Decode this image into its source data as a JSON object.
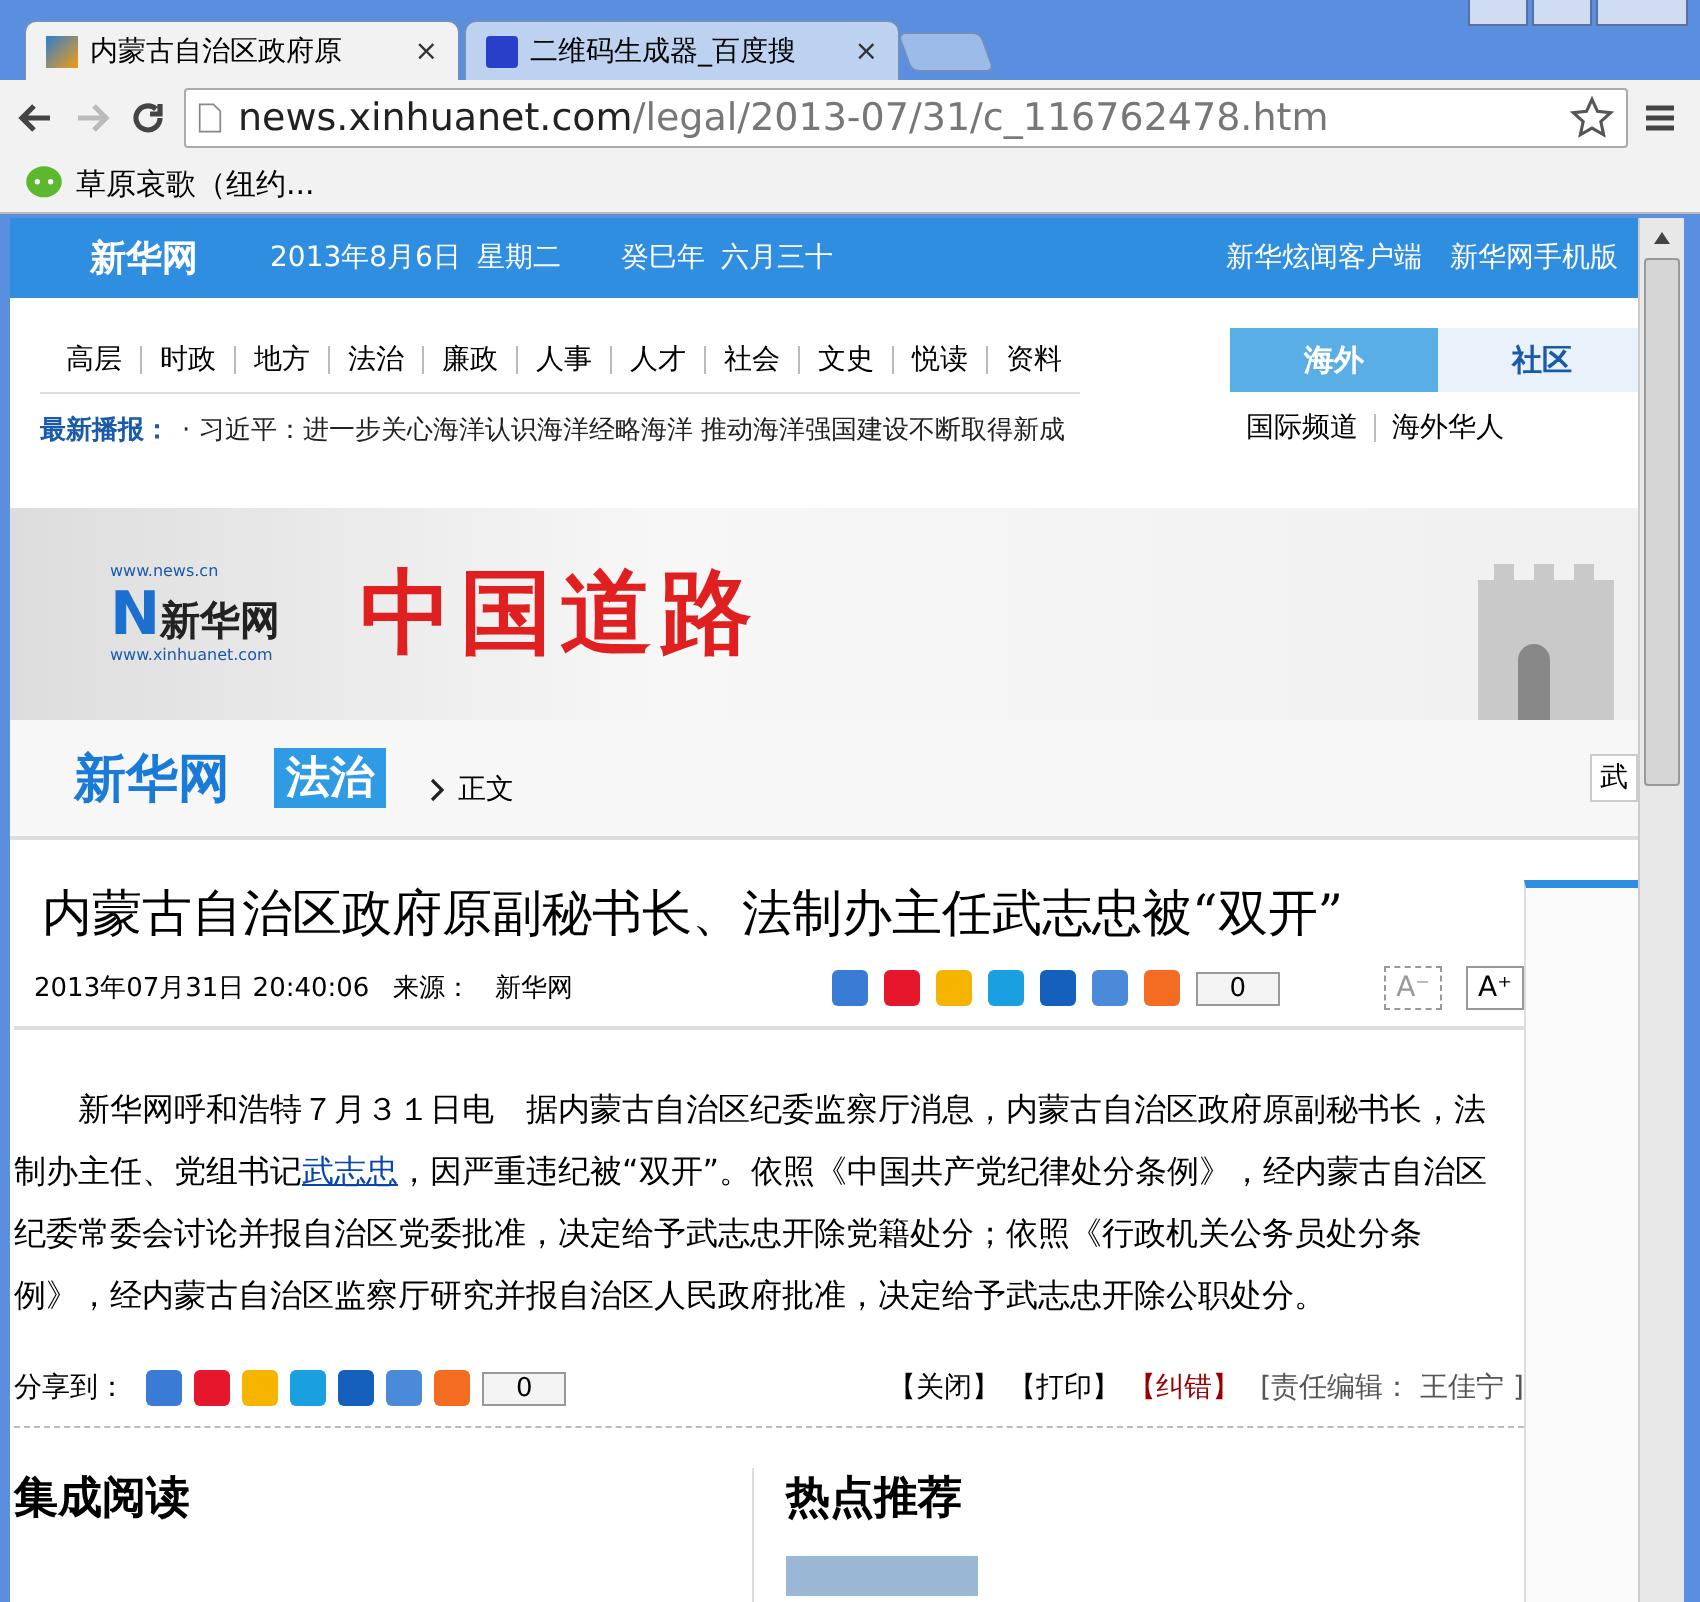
{
  "browser": {
    "tabs": [
      {
        "title": "内蒙古自治区政府原",
        "close": "×",
        "selected": true
      },
      {
        "title": "二维码生成器_百度搜",
        "close": "×",
        "selected": false
      }
    ],
    "url_host": "news.xinhuanet.com",
    "url_path": "/legal/2013-07/31/c_116762478.htm",
    "bookmark": "草原哀歌（纽约..."
  },
  "header": {
    "logo": "新华网",
    "date": "2013年8月6日",
    "weekday": "星期二",
    "lunar_year": "癸巳年",
    "lunar_day": "六月三十",
    "links": [
      "新华炫闻客户端",
      "新华网手机版"
    ]
  },
  "nav": {
    "items": [
      "高层",
      "时政",
      "地方",
      "法治",
      "廉政",
      "人事",
      "人才",
      "社会",
      "文史",
      "悦读",
      "资料"
    ],
    "ticker_label": "最新播报：",
    "ticker": "· 习近平：进一步关心海洋认识海洋经略海洋  推动海洋强国建设不断取得新成",
    "side_tabs": [
      {
        "label": "海外",
        "selected": true
      },
      {
        "label": "社区",
        "selected": false
      }
    ],
    "side_links": [
      "国际频道",
      "海外华人"
    ]
  },
  "banner": {
    "logo_top": "www.news.cn",
    "logo_letter": "N",
    "logo_name": "新华网",
    "logo_bottom": "www.xinhuanet.com",
    "title": "中国道路"
  },
  "breadcrumb": {
    "site": "新华网",
    "channel": "法治",
    "current": "正文",
    "side": "武"
  },
  "article": {
    "title": "内蒙古自治区政府原副秘书长、法制办主任武志忠被“双开”",
    "datetime": "2013年07月31日 20:40:06",
    "source_label": "来源：",
    "source": "新华网",
    "share_count": "0",
    "font_smaller": "A⁻",
    "font_larger": "A⁺",
    "text_before": "新华网呼和浩特７月３１日电　据内蒙古自治区纪委监察厅消息，内蒙古自治区政府原副秘书长，法制办主任、党组书记",
    "link": "武志忠",
    "text_after": "，因严重违纪被“双开”。依照《中国共产党纪律处分条例》，经内蒙古自治区纪委常委会讨论并报自治区党委批准，决定给予武志忠开除党籍处分；依照《行政机关公务员处分条例》，经内蒙古自治区监察厅研究并报自治区人民政府批准，决定给予武志忠开除公职处分。",
    "share_label": "分享到：",
    "share_count2": "0",
    "actions": [
      "【关闭】",
      "【打印】",
      "【纠错】"
    ],
    "editor": "[责任编辑：  王佳宁 ]"
  },
  "sections": [
    "集成阅读",
    "热点推荐"
  ]
}
